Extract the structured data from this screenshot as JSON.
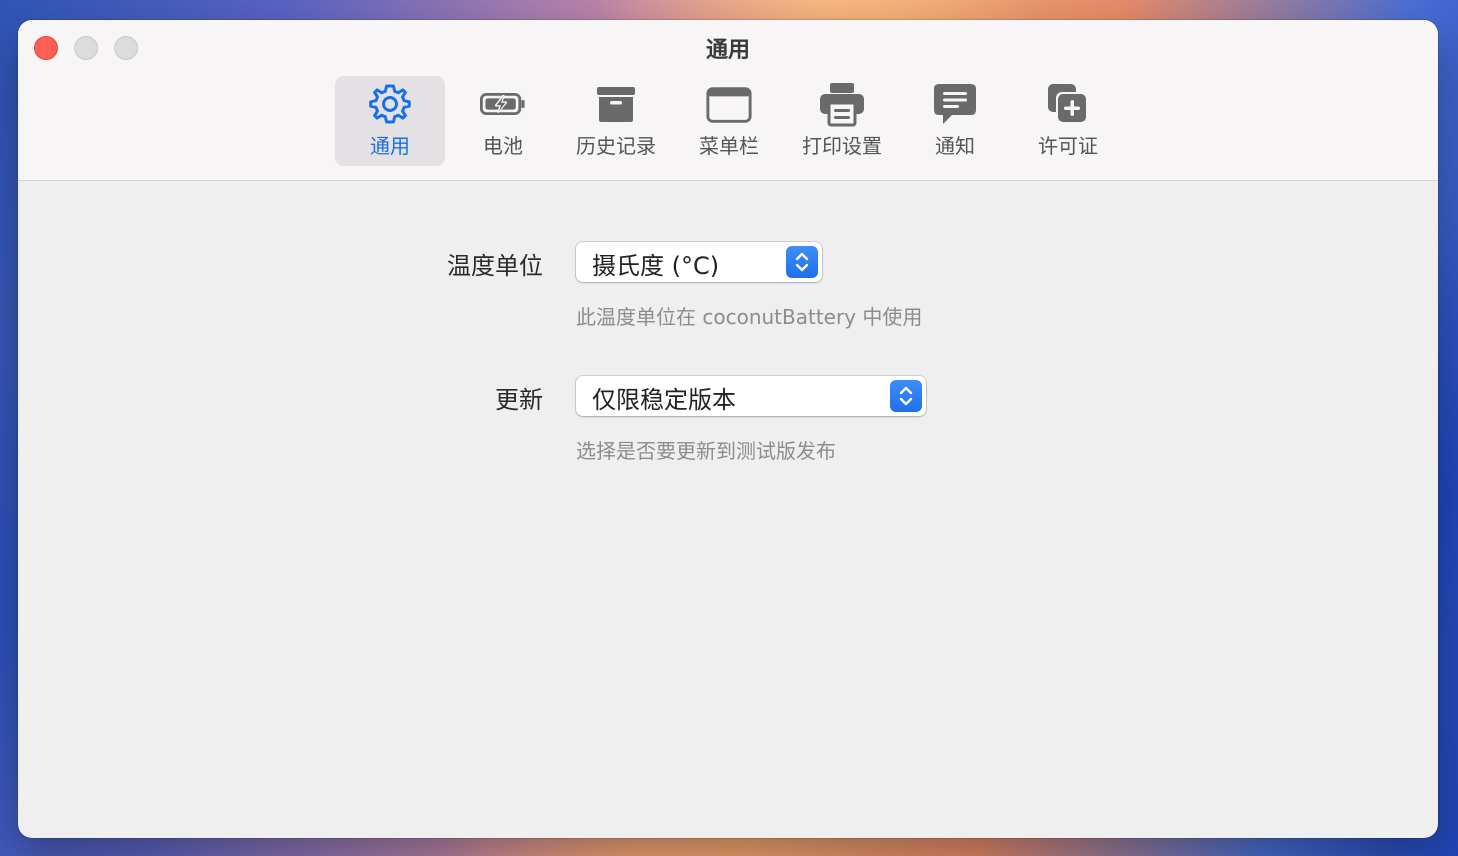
{
  "window": {
    "title": "通用"
  },
  "toolbar": {
    "items": [
      {
        "label": "通用",
        "icon": "gear-icon",
        "selected": true
      },
      {
        "label": "电池",
        "icon": "battery-icon",
        "selected": false
      },
      {
        "label": "历史记录",
        "icon": "archive-box-icon",
        "selected": false
      },
      {
        "label": "菜单栏",
        "icon": "menu-bar-window-icon",
        "selected": false
      },
      {
        "label": "打印设置",
        "icon": "printer-icon",
        "selected": false
      },
      {
        "label": "通知",
        "icon": "message-bubble-icon",
        "selected": false
      },
      {
        "label": "许可证",
        "icon": "license-plus-icon",
        "selected": false
      }
    ]
  },
  "settings": {
    "temperature": {
      "label": "温度单位",
      "value": "摄氏度 (°C)",
      "hint": "此温度单位在 coconutBattery 中使用"
    },
    "updates": {
      "label": "更新",
      "value": "仅限稳定版本",
      "hint": "选择是否要更新到测试版发布"
    }
  },
  "colors": {
    "accent": "#1a6ee8",
    "close_button": "#fe5f57",
    "icon_gray": "#6a6a6a"
  }
}
